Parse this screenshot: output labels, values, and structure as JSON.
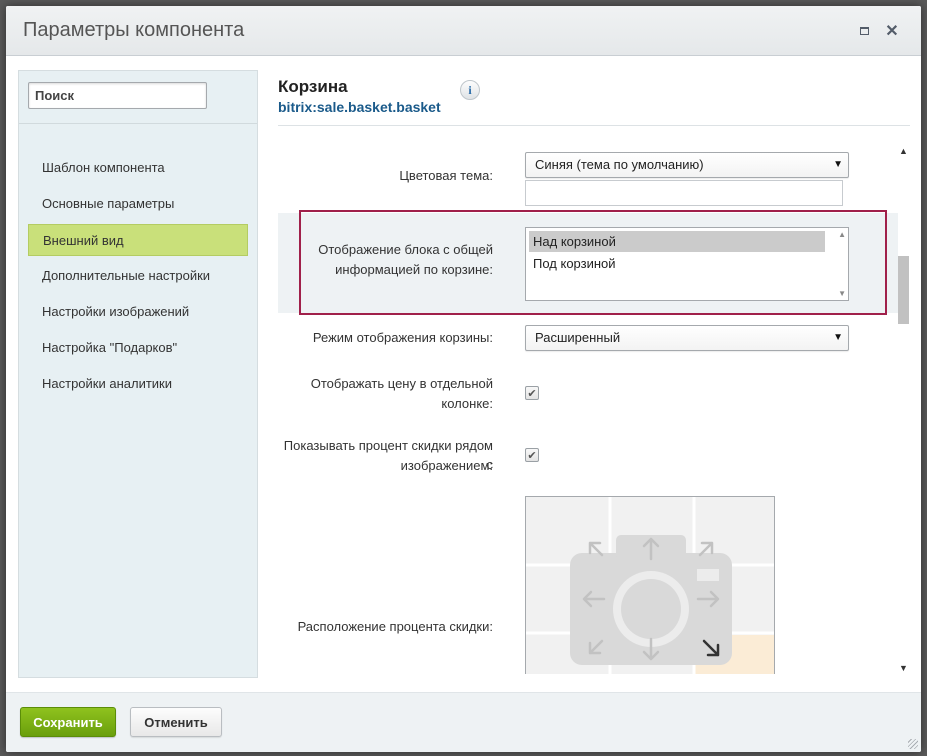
{
  "dialog": {
    "title": "Параметры компонента"
  },
  "sidebar": {
    "search_placeholder": "Поиск",
    "items": [
      {
        "label": "Шаблон компонента"
      },
      {
        "label": "Основные параметры"
      },
      {
        "label": "Внешний вид"
      },
      {
        "label": "Дополнительные настройки"
      },
      {
        "label": "Настройки изображений"
      },
      {
        "label": "Настройка \"Подарков\""
      },
      {
        "label": "Настройки аналитики"
      }
    ]
  },
  "component": {
    "title": "Корзина",
    "code": "bitrix:sale.basket.basket",
    "info_glyph": "i"
  },
  "fields": {
    "color_theme": {
      "label": "Цветовая тема:",
      "value": "Синяя (тема по умолчанию)"
    },
    "info_block": {
      "label_line1": "Отображение блока с общей",
      "label_line2": "информацией по корзине:",
      "options": [
        "Над корзиной",
        "Под корзиной"
      ],
      "selected": "Над корзиной"
    },
    "display_mode": {
      "label": "Режим отображения корзины:",
      "value": "Расширенный"
    },
    "price_column": {
      "label_line1": "Отображать цену в отдельной",
      "label_line2": "колонке:",
      "checked": true
    },
    "discount_percent": {
      "label_line1": "Показывать процент скидки рядом с",
      "label_line2": "изображением:",
      "checked": true
    },
    "discount_position": {
      "label": "Расположение процента скидки:",
      "selected": "bottom-right"
    }
  },
  "footer": {
    "save_label": "Сохранить",
    "cancel_label": "Отменить"
  },
  "colors": {
    "active_item": "#c9e07a",
    "highlight_border": "#a0204a",
    "save_button": "#7ab317",
    "code_text": "#1a5a8a"
  }
}
